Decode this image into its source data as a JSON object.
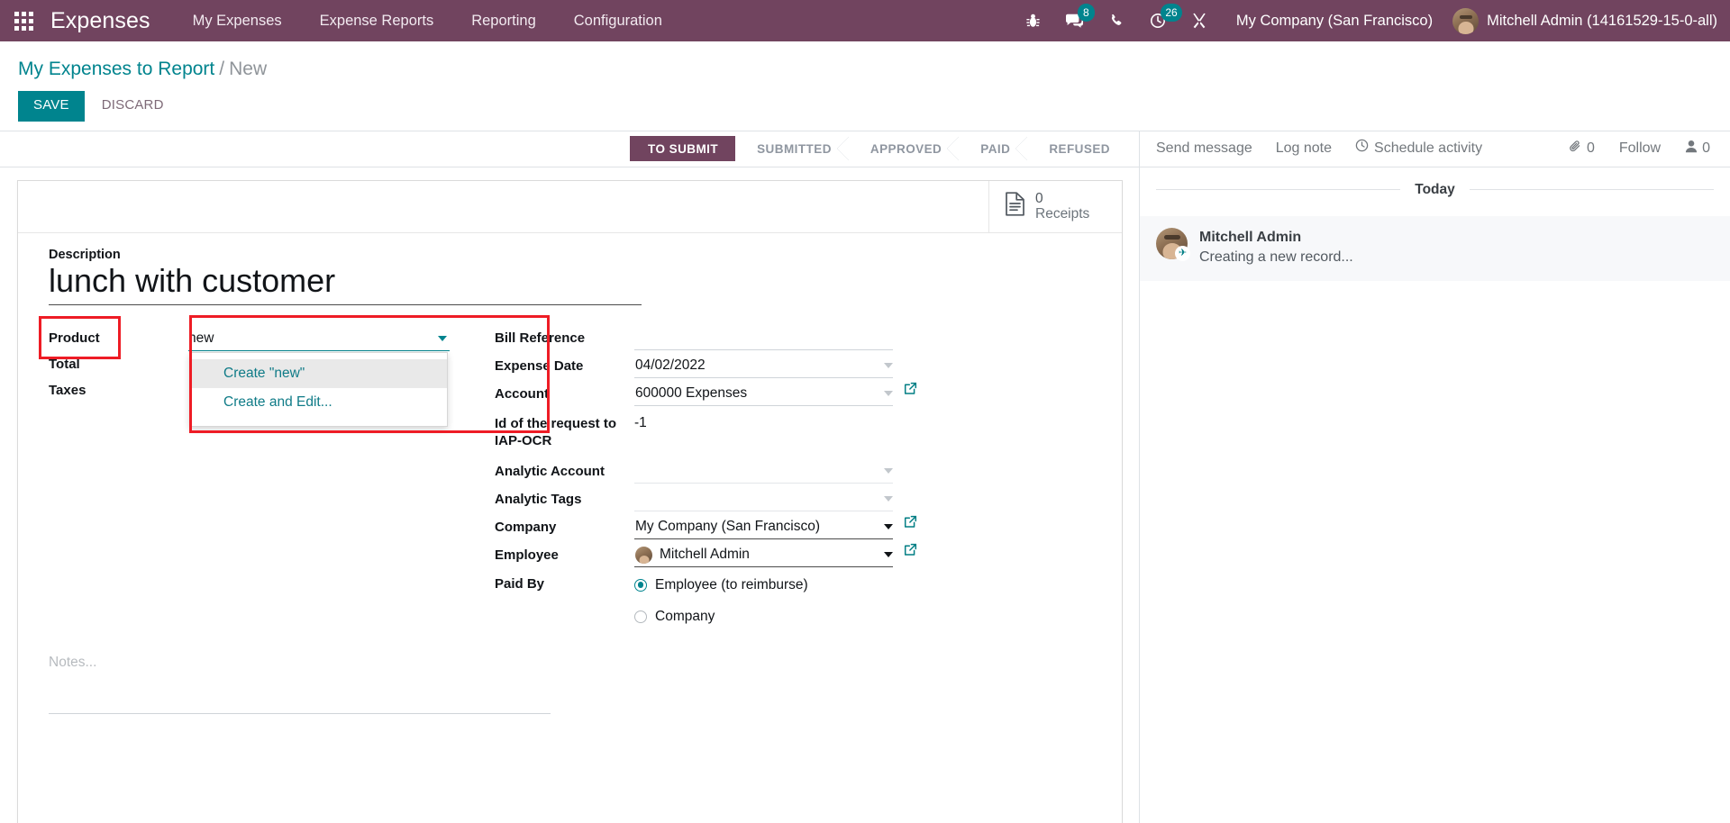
{
  "navbar": {
    "apps_icon": "apps-grid-icon",
    "brand": "Expenses",
    "menus": [
      {
        "label": "My Expenses"
      },
      {
        "label": "Expense Reports"
      },
      {
        "label": "Reporting"
      },
      {
        "label": "Configuration"
      }
    ],
    "sys_icons": [
      {
        "name": "bug-icon",
        "badge": ""
      },
      {
        "name": "messages-icon",
        "badge": "8"
      },
      {
        "name": "phone-icon",
        "badge": ""
      },
      {
        "name": "activities-clock-icon",
        "badge": "26"
      },
      {
        "name": "tools-icon",
        "badge": ""
      }
    ],
    "company": "My Company (San Francisco)",
    "user": "Mitchell Admin (14161529-15-0-all)"
  },
  "control_panel": {
    "breadcrumb_root": "My Expenses to Report",
    "breadcrumb_sep": "/",
    "breadcrumb_current": "New",
    "save_label": "SAVE",
    "discard_label": "DISCARD"
  },
  "statusbar": {
    "stages": [
      {
        "label": "TO SUBMIT",
        "active": true
      },
      {
        "label": "SUBMITTED",
        "active": false
      },
      {
        "label": "APPROVED",
        "active": false
      },
      {
        "label": "PAID",
        "active": false
      },
      {
        "label": "REFUSED",
        "active": false
      }
    ]
  },
  "stat_button": {
    "icon": "receipt-document-icon",
    "value": "0",
    "label": "Receipts"
  },
  "form": {
    "description_label": "Description",
    "description_value": "lunch with customer",
    "left_fields": [
      {
        "label": "Product"
      },
      {
        "label": "Total"
      },
      {
        "label": "Taxes"
      }
    ],
    "product": {
      "label": "Product",
      "value": "new",
      "placeholder": "",
      "dropdown": [
        {
          "label": "Create \"new\"",
          "highlighted": true
        },
        {
          "label": "Create and Edit...",
          "highlighted": false
        }
      ]
    },
    "right_fields": [
      {
        "label": "Bill Reference",
        "value": "",
        "type": "text",
        "caret": false,
        "external": false
      },
      {
        "label": "Expense Date",
        "value": "04/02/2022",
        "type": "date",
        "caret": true,
        "external": false
      },
      {
        "label": "Account",
        "value": "600000 Expenses",
        "type": "m2o",
        "caret": true,
        "external": true
      },
      {
        "label": "Id of the request to IAP-OCR",
        "value": "-1",
        "type": "static",
        "caret": false,
        "external": false
      },
      {
        "label": "Analytic Account",
        "value": "",
        "type": "m2o",
        "caret": true,
        "external": false
      },
      {
        "label": "Analytic Tags",
        "value": "",
        "type": "m2m",
        "caret": true,
        "external": false
      },
      {
        "label": "Company",
        "value": "My Company (San Francisco)",
        "type": "m2o",
        "caret": true,
        "external": true
      },
      {
        "label": "Employee",
        "value": "Mitchell Admin",
        "type": "m2o-avatar",
        "caret": true,
        "external": true
      }
    ],
    "paid_by": {
      "label": "Paid By",
      "options": [
        {
          "label": "Employee (to reimburse)",
          "selected": true
        },
        {
          "label": "Company",
          "selected": false
        }
      ]
    },
    "notes_placeholder": "Notes..."
  },
  "chatter": {
    "send_message": "Send message",
    "log_note": "Log note",
    "schedule_activity": "Schedule activity",
    "attachment_count": "0",
    "follow_label": "Follow",
    "follower_count": "0",
    "day_label": "Today",
    "message": {
      "author": "Mitchell Admin",
      "body": "Creating a new record..."
    }
  },
  "colors": {
    "brand_purple": "#71445f",
    "accent_teal": "#00848e",
    "highlight_red": "#ee1c25",
    "link_teal": "#0f7b87"
  }
}
